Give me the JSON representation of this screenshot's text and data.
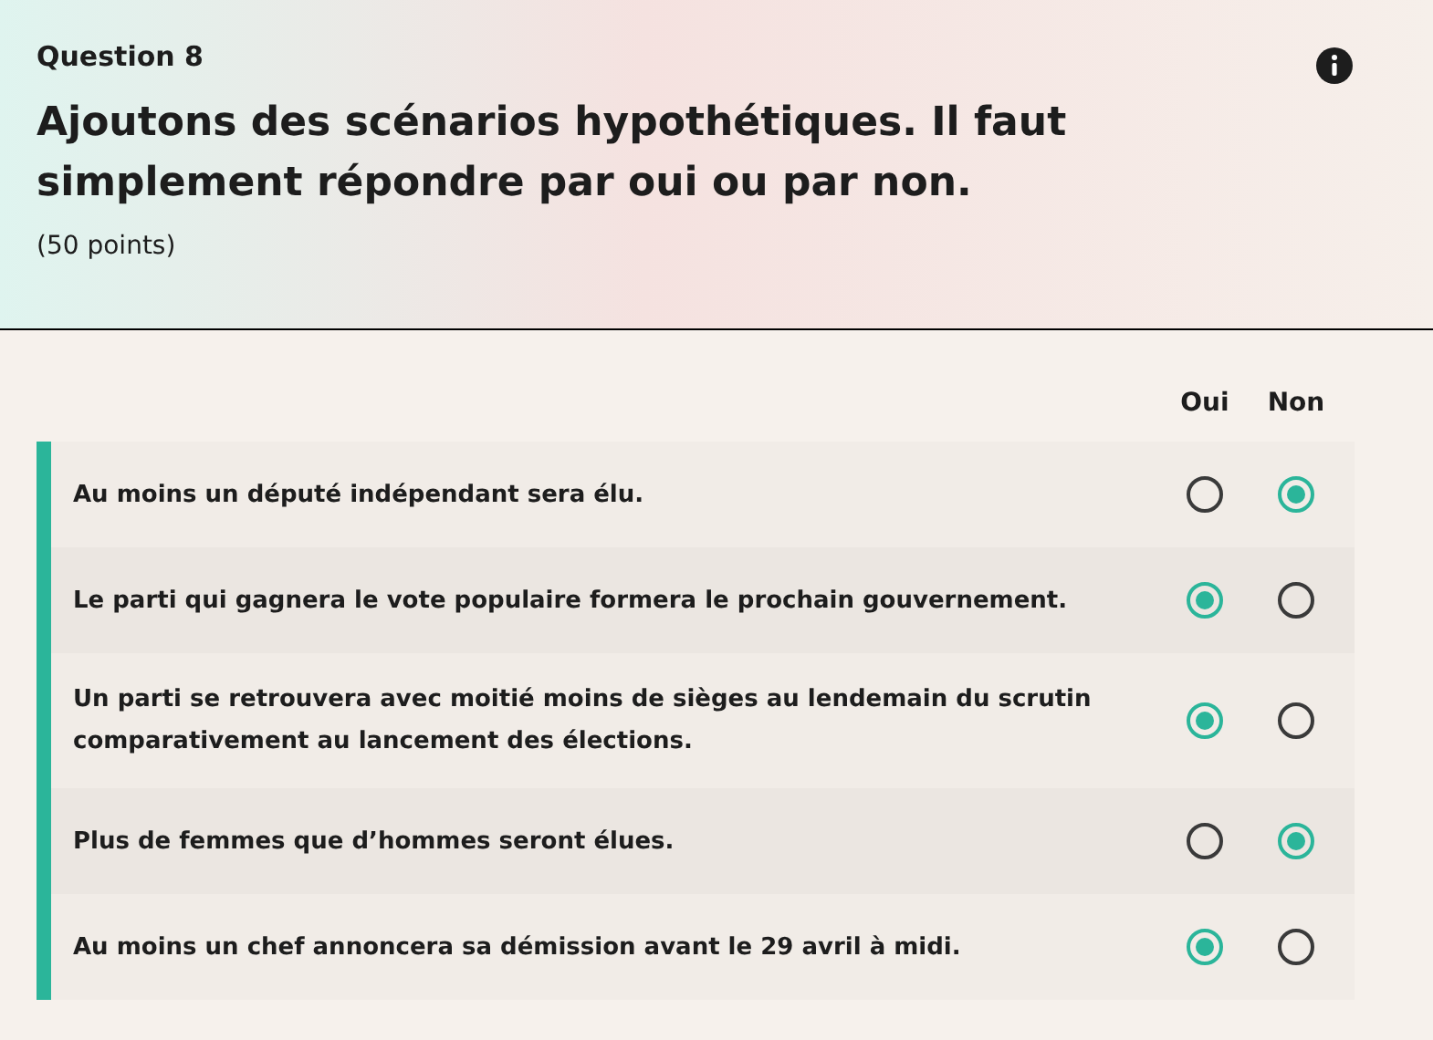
{
  "question": {
    "label": "Question 8",
    "title": "Ajoutons des scénarios hypothétiques. Il faut simplement répondre par oui ou par non.",
    "points": "(50 points)"
  },
  "columns": [
    "Oui",
    "Non"
  ],
  "rows": [
    {
      "text": "Au moins un député indépendant sera élu.",
      "options": [
        {
          "selected": false
        },
        {
          "selected": true
        }
      ]
    },
    {
      "text": "Le parti qui gagnera le vote populaire formera le prochain gouvernement.",
      "options": [
        {
          "selected": true
        },
        {
          "selected": false
        }
      ]
    },
    {
      "text": "Un parti se retrouvera avec moitié moins de sièges au lendemain du scrutin comparativement au lancement des élections.",
      "options": [
        {
          "selected": true
        },
        {
          "selected": false
        }
      ]
    },
    {
      "text": "Plus de femmes que d’hommes seront élues.",
      "options": [
        {
          "selected": false
        },
        {
          "selected": true
        }
      ]
    },
    {
      "text": "Au moins un chef annoncera sa démission avant le 29 avril à midi.",
      "options": [
        {
          "selected": true
        },
        {
          "selected": false
        }
      ]
    }
  ]
}
